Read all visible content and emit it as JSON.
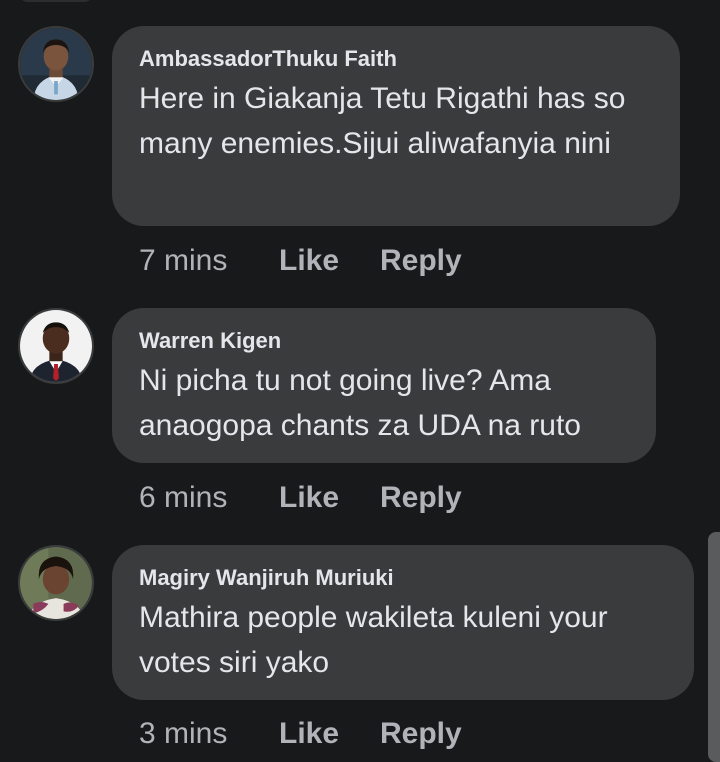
{
  "comments": [
    {
      "author": "AmbassadorThuku Faith",
      "text": "Here in Giakanja Tetu Rigathi has so many enemies.Sijui aliwafanyia nini",
      "time": "7 mins",
      "like_label": "Like",
      "reply_label": "Reply",
      "avatar_icon": "profile-photo-woman-icon"
    },
    {
      "author": "Warren Kigen",
      "text": "Ni picha tu not going live? Ama anaogopa chants za UDA na ruto",
      "time": "6 mins",
      "like_label": "Like",
      "reply_label": "Reply",
      "avatar_icon": "profile-photo-man-icon"
    },
    {
      "author": "Magiry Wanjiruh Muriuki",
      "text": "Mathira people wakileta kuleni your votes siri yako",
      "time": "3 mins",
      "like_label": "Like",
      "reply_label": "Reply",
      "avatar_icon": "profile-photo-woman-icon"
    }
  ],
  "colors": {
    "background": "#18191a",
    "bubble": "#3a3b3c",
    "primary_text": "#e4e6eb",
    "secondary_text": "#b0b3b8"
  }
}
